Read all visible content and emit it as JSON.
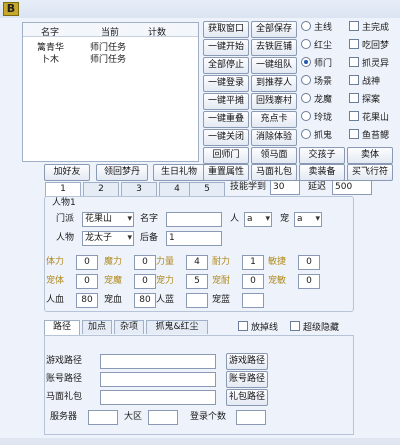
{
  "app": {
    "logo": "B"
  },
  "list": {
    "headers": [
      "名字",
      "当前",
      "计数"
    ],
    "rows": [
      {
        "name": "篱青华",
        "current": "师门任务",
        "count": ""
      },
      {
        "name": "卜木",
        "current": "师门任务",
        "count": ""
      }
    ]
  },
  "actions": [
    [
      "获取窗口",
      "全部保存"
    ],
    [
      "一键开始",
      "去铁匠铺"
    ],
    [
      "全部停止",
      "一键组队"
    ],
    [
      "一键登录",
      "到推荐人"
    ],
    [
      "一键平摊",
      "回残寨村"
    ],
    [
      "一键重叠",
      "充点卡"
    ],
    [
      "一键关闭",
      "消除体验"
    ],
    [
      "回师门",
      "领马面"
    ]
  ],
  "task_radios": [
    {
      "label": "主线",
      "on": false
    },
    {
      "label": "红尘",
      "on": false
    },
    {
      "label": "师门",
      "on": true
    },
    {
      "label": "场景",
      "on": false
    },
    {
      "label": "龙魔",
      "on": false
    },
    {
      "label": "玲珑",
      "on": false
    },
    {
      "label": "抓鬼",
      "on": false
    }
  ],
  "task_checks": [
    "主完成",
    "吃回梦",
    "抓灵异",
    "战神",
    "探案",
    "花果山",
    "鱼苔鳃"
  ],
  "row_buttons": [
    "加好友",
    "领回梦丹",
    "生日礼物",
    "重置属性",
    "马面礼包",
    "交孩子",
    "卖装备",
    "卖体",
    "买飞行符"
  ],
  "char_tabs": [
    "1",
    "2",
    "3",
    "4",
    "5"
  ],
  "skill": {
    "label": "技能学到",
    "value": "30",
    "delay_label": "延迟",
    "delay_value": "500"
  },
  "character": {
    "title": "人物1",
    "sect_label": "门派",
    "sect_value": "花果山",
    "name_label": "名字",
    "name_value": "",
    "person_label": "人",
    "person_value": "a",
    "pet_label": "宠",
    "pet_value": "a",
    "char_label": "人物",
    "char_value": "龙太子",
    "backup_label": "后备",
    "backup_value": "1"
  },
  "stats": {
    "row1": [
      {
        "label": "体力",
        "value": "0"
      },
      {
        "label": "魔力",
        "value": "0"
      },
      {
        "label": "力量",
        "value": "4"
      },
      {
        "label": "耐力",
        "value": "1"
      },
      {
        "label": "敏捷",
        "value": "0"
      }
    ],
    "row2": [
      {
        "label": "宠体",
        "value": "0"
      },
      {
        "label": "宠魔",
        "value": "0"
      },
      {
        "label": "宠力",
        "value": "5"
      },
      {
        "label": "宠耐",
        "value": "0"
      },
      {
        "label": "宠敏",
        "value": "0"
      }
    ],
    "row3": [
      {
        "label": "人血",
        "value": "80"
      },
      {
        "label": "宠血",
        "value": "80"
      },
      {
        "label": "人蓝",
        "value": ""
      },
      {
        "label": "宠蓝",
        "value": ""
      }
    ]
  },
  "bottom_tabs": [
    "路径",
    "加点",
    "杂项",
    "抓鬼&红尘"
  ],
  "bottom_checks": [
    "放掉线",
    "超级隐藏"
  ],
  "paths": {
    "game_label": "游戏路径",
    "game_btn": "游戏路径",
    "account_label": "账号路径",
    "account_btn": "账号路径",
    "horse_label": "马面礼包",
    "horse_btn": "礼包路径",
    "server_label": "服务器",
    "zone_label": "大区",
    "login_label": "登录个数"
  }
}
